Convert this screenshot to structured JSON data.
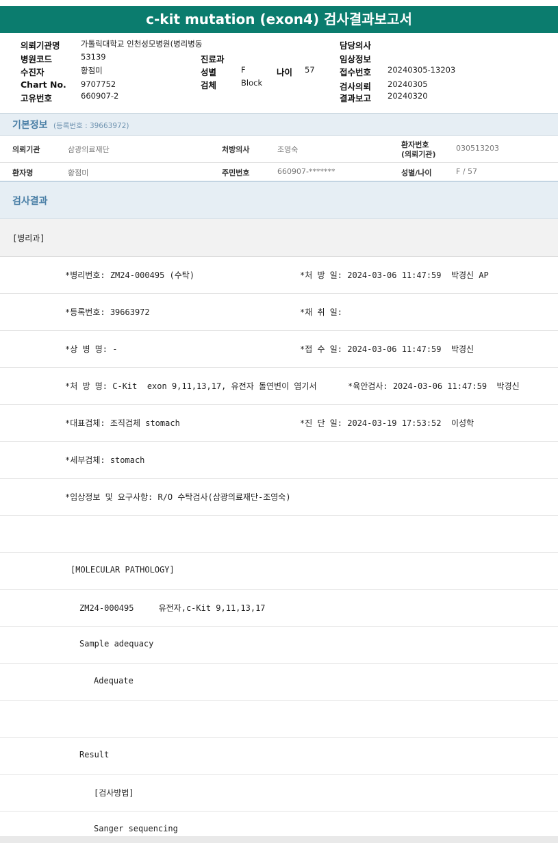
{
  "report_title": "c-kit mutation (exon4) 검사결과보고서",
  "header": {
    "labels": {
      "institution": "의뢰기관명",
      "hospital_code": "병원코드",
      "patient": "수진자",
      "chart_no": "Chart No.",
      "unique_no": "고유번호",
      "department": "진료과",
      "sex": "성별",
      "age": "나이",
      "specimen": "검체",
      "doctor": "담당의사",
      "clinical_info": "임상정보",
      "receipt_no": "접수번호",
      "request_date": "검사의뢰",
      "report_date": "결과보고"
    },
    "values": {
      "institution": "가톨릭대학교 인천성모병원(병리병동",
      "hospital_code": "53139",
      "patient": "황점미",
      "chart_no": "9707752",
      "unique_no": "660907-2",
      "sex": "F",
      "age": "57",
      "specimen": "Block",
      "receipt_no": "20240305-13203",
      "request_date": "20240305",
      "report_date": "20240320"
    }
  },
  "basic_info": {
    "title": "기본정보",
    "subtitle": "(등록번호 : 39663972)",
    "row1": {
      "institution_label": "의뢰기관",
      "institution_value": "삼광의료재단",
      "doctor_label": "처방의사",
      "doctor_value": "조영숙",
      "patient_no_label_1": "환자번호",
      "patient_no_label_2": "(의뢰기관)",
      "patient_no_value": "030513203"
    },
    "row2": {
      "name_label": "환자명",
      "name_value": "황점미",
      "rrn_label": "주민번호",
      "rrn_value": "660907-*******",
      "sex_age_label": "성별/나이",
      "sex_age_value": "F / 57"
    }
  },
  "result": {
    "title": "검사결과",
    "department": "[병리과]",
    "lines": {
      "pathology_no": "*병리번호: ZM24-000495 (수탁)",
      "prescribe_date": "*처 방 일: 2024-03-06 11:47:59  박경신 AP",
      "reg_no": "*등록번호: 39663972",
      "collect_date": "*채 취 일:",
      "diagnosis_name": "*상 병 명: -",
      "receive_date": "*접 수 일: 2024-03-06 11:47:59  박경신",
      "order_name": "*처 방 명: C-Kit  exon 9,11,13,17, 유전자 돌연변이 염기서",
      "gross_exam": "*육안검사: 2024-03-06 11:47:59  박경신",
      "main_specimen": "*대표검체: 조직검체 stomach",
      "diag_date": "*진 단 일: 2024-03-19 17:53:52  이성학",
      "sub_specimen": "*세부검체: stomach",
      "clinical_req": "*임상정보 및 요구사항: R/O 수탁검사(삼광의료재단-조영숙)",
      "mol_path": "[MOLECULAR PATHOLOGY]",
      "case_line": "ZM24-000495     유전자,c-Kit 9,11,13,17",
      "sample_adequacy": "Sample adequacy",
      "adequate": "Adequate",
      "result_label": "Result",
      "method_label": "[검사방법]",
      "method_value": "Sanger sequencing"
    }
  }
}
